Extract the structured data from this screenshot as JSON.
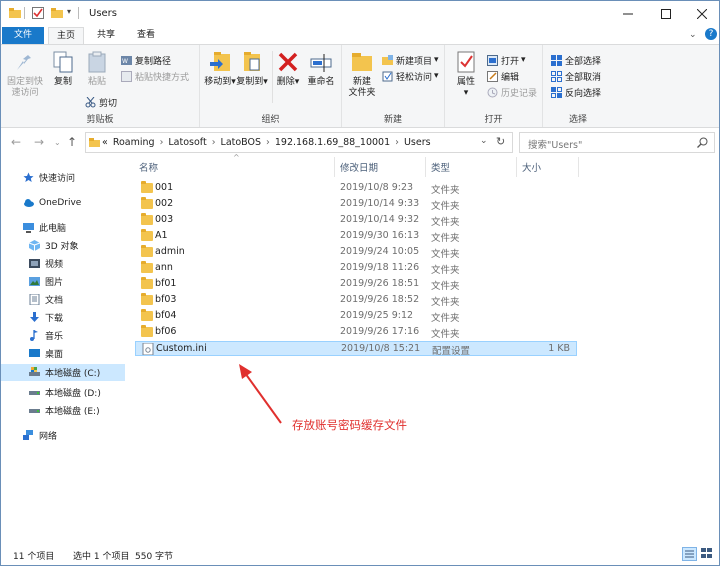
{
  "window": {
    "title": "Users"
  },
  "ribbon_tabs": {
    "file": "文件",
    "home": "主页",
    "share": "共享",
    "view": "查看"
  },
  "ribbon": {
    "clipboard": {
      "pin": "固定到快\n速访问",
      "copy": "复制",
      "paste": "粘贴",
      "copy_path": "复制路径",
      "paste_shortcut": "粘贴快捷方式",
      "cut": "剪切",
      "label": "剪贴板"
    },
    "organize": {
      "move_to": "移动到",
      "copy_to": "复制到",
      "delete": "删除",
      "rename": "重命名",
      "label": "组织"
    },
    "new": {
      "new_folder": "新建\n文件夹",
      "new_item": "新建项目",
      "easy_access": "轻松访问",
      "label": "新建"
    },
    "open": {
      "properties": "属性",
      "open": "打开",
      "edit": "编辑",
      "history": "历史记录",
      "label": "打开"
    },
    "select": {
      "select_all": "全部选择",
      "select_none": "全部取消",
      "invert": "反向选择",
      "label": "选择"
    }
  },
  "address": {
    "crumbs": [
      "«",
      "Roaming",
      "Latosoft",
      "LatoBOS",
      "192.168.1.69_88_10001",
      "Users"
    ],
    "search_placeholder": "搜索\"Users\""
  },
  "nav": {
    "quick_access": "快速访问",
    "onedrive": "OneDrive",
    "this_pc": "此电脑",
    "objects3d": "3D 对象",
    "videos": "视频",
    "pictures": "图片",
    "documents": "文档",
    "downloads": "下载",
    "music": "音乐",
    "desktop": "桌面",
    "drive_c": "本地磁盘 (C:)",
    "drive_d": "本地磁盘 (D:)",
    "drive_e": "本地磁盘 (E:)",
    "network": "网络"
  },
  "columns": {
    "name": "名称",
    "date": "修改日期",
    "type": "类型",
    "size": "大小"
  },
  "files": [
    {
      "name": "001",
      "date": "2019/10/8 9:23",
      "type": "文件夹",
      "size": ""
    },
    {
      "name": "002",
      "date": "2019/10/14 9:33",
      "type": "文件夹",
      "size": ""
    },
    {
      "name": "003",
      "date": "2019/10/14 9:32",
      "type": "文件夹",
      "size": ""
    },
    {
      "name": "A1",
      "date": "2019/9/30 16:13",
      "type": "文件夹",
      "size": ""
    },
    {
      "name": "admin",
      "date": "2019/9/24 10:05",
      "type": "文件夹",
      "size": ""
    },
    {
      "name": "ann",
      "date": "2019/9/18 11:26",
      "type": "文件夹",
      "size": ""
    },
    {
      "name": "bf01",
      "date": "2019/9/26 18:51",
      "type": "文件夹",
      "size": ""
    },
    {
      "name": "bf03",
      "date": "2019/9/26 18:52",
      "type": "文件夹",
      "size": ""
    },
    {
      "name": "bf04",
      "date": "2019/9/25 9:12",
      "type": "文件夹",
      "size": ""
    },
    {
      "name": "bf06",
      "date": "2019/9/26 17:16",
      "type": "文件夹",
      "size": ""
    },
    {
      "name": "Custom.ini",
      "date": "2019/10/8 15:21",
      "type": "配置设置",
      "size": "1 KB"
    }
  ],
  "annotation": "存放账号密码缓存文件",
  "status": {
    "count": "11 个项目",
    "selected": "选中 1 个项目",
    "size": "550 字节"
  },
  "colors": {
    "accent": "#1979ca",
    "selection": "#cce8ff",
    "annotation": "#e0302e",
    "folder": "#f3c44e"
  }
}
